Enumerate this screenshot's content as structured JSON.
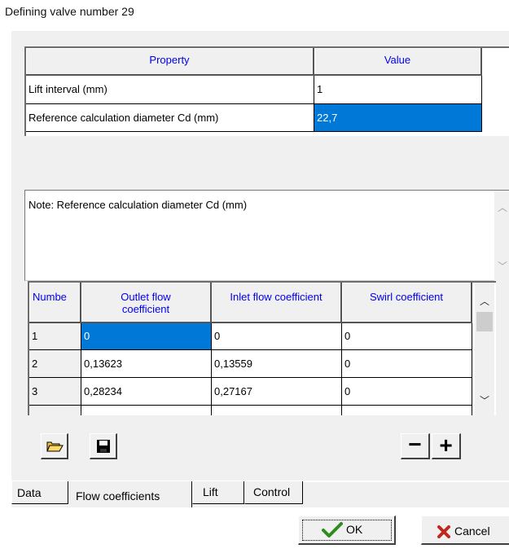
{
  "dialog": {
    "title": "Defining valve number 29"
  },
  "property_grid": {
    "headers": {
      "property": "Property",
      "value": "Value"
    },
    "rows": [
      {
        "property": "Lift interval (mm)",
        "value": "1"
      },
      {
        "property": "Reference calculation diameter Cd (mm)",
        "value": "22,7",
        "selected": true
      }
    ]
  },
  "note": {
    "text": "Note: Reference calculation diameter Cd (mm)"
  },
  "coefficients_table": {
    "headers": {
      "number": "Numbe",
      "outlet_line1": "Outlet flow",
      "outlet_line2": "coefficient",
      "inlet": "Inlet flow coefficient",
      "swirl": "Swirl coefficient"
    },
    "rows": [
      {
        "number": "1",
        "outlet": "0",
        "inlet": "0",
        "swirl": "0"
      },
      {
        "number": "2",
        "outlet": "0,13623",
        "inlet": "0,13559",
        "swirl": "0"
      },
      {
        "number": "3",
        "outlet": "0,28234",
        "inlet": "0,27167",
        "swirl": "0"
      }
    ]
  },
  "toolbar": {
    "open_icon": "folder-open-icon",
    "save_icon": "floppy-disk-icon",
    "remove_label": "−",
    "add_label": "+"
  },
  "tabs": [
    {
      "label": "Data",
      "active": false
    },
    {
      "label": "Flow coefficients",
      "active": true
    },
    {
      "label": "Lift",
      "active": false
    },
    {
      "label": "Control",
      "active": false
    }
  ],
  "buttons": {
    "ok_label": "OK",
    "cancel_label": "Cancel"
  },
  "colors": {
    "selection": "#0078d7",
    "header_text": "#0000ee",
    "ok_check": "#2e8b1e",
    "cancel_x": "#c0281e"
  }
}
